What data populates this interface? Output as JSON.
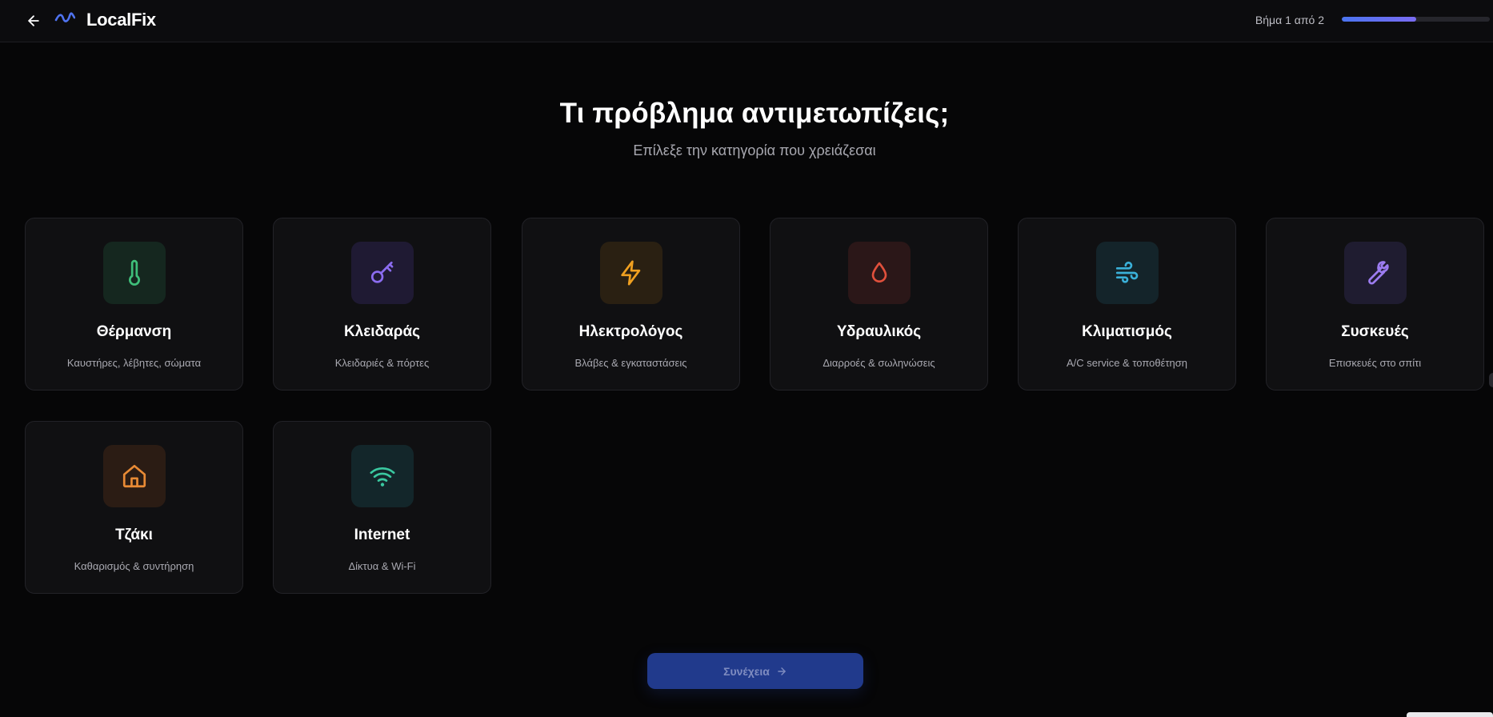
{
  "header": {
    "brand": "LocalFix",
    "step_text": "Βήμα 1 από 2",
    "progress": 0.5
  },
  "main": {
    "title": "Τι πρόβλημα αντιμετωπίζεις;",
    "subtitle": "Επίλεξε την κατηγορία που χρειάζεσαι"
  },
  "categories": [
    {
      "title": "Θέρμανση",
      "desc": "Καυστήρες, λέβητες, σώματα",
      "icon": "thermometer-icon",
      "color": "#3fbf7a",
      "bg": "#15271f"
    },
    {
      "title": "Κλειδαράς",
      "desc": "Κλειδαριές & πόρτες",
      "icon": "key-icon",
      "color": "#8b6cf0",
      "bg": "#1f1a33"
    },
    {
      "title": "Ηλεκτρολόγος",
      "desc": "Βλάβες & εγκαταστάσεις",
      "icon": "lightning-icon",
      "color": "#f0a020",
      "bg": "#2a2012"
    },
    {
      "title": "Υδραυλικός",
      "desc": "Διαρροές & σωληνώσεις",
      "icon": "water-drop-icon",
      "color": "#e0503c",
      "bg": "#2b1718"
    },
    {
      "title": "Κλιματισμός",
      "desc": "A/C service & τοποθέτηση",
      "icon": "wind-icon",
      "color": "#3ab0d8",
      "bg": "#14242a"
    },
    {
      "title": "Συσκευές",
      "desc": "Επισκευές στο σπίτι",
      "icon": "wrench-icon",
      "color": "#9c7cf0",
      "bg": "#1f1c30"
    },
    {
      "title": "Τζάκι",
      "desc": "Καθαρισμός & συντήρηση",
      "icon": "house-icon",
      "color": "#e88a35",
      "bg": "#2b1c14"
    },
    {
      "title": "Internet",
      "desc": "Δίκτυα & Wi-Fi",
      "icon": "wifi-icon",
      "color": "#3ac8a0",
      "bg": "#13262a"
    }
  ],
  "footer": {
    "continue_label": "Συνέχεια"
  }
}
